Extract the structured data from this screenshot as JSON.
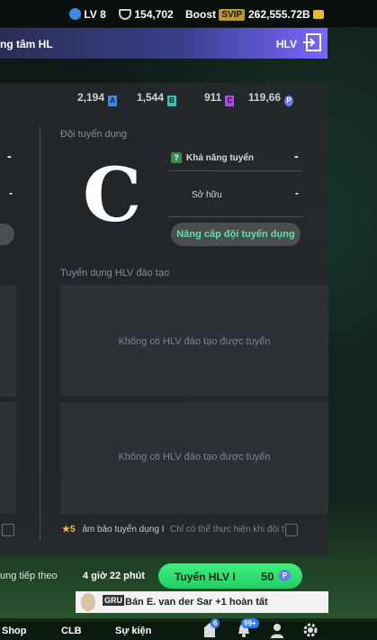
{
  "topbar": {
    "level": "LV 8",
    "points": "154,702",
    "boost_label": "Boost",
    "vip_badge": "SVIP",
    "coins": "262,555.72B"
  },
  "header": {
    "title": "ng tâm HL",
    "right_label": "HLV"
  },
  "currencies": [
    {
      "value": "2,194",
      "badge": "A",
      "color": "#3a8be8"
    },
    {
      "value": "1,544",
      "badge": "B",
      "color": "#2ec4b0"
    },
    {
      "value": "911",
      "badge": "C",
      "color": "#b04ae8"
    },
    {
      "value": "119,66",
      "badge": "P",
      "color": "#6a7ae8"
    }
  ],
  "recruit_team": {
    "label": "Đội tuyển dụng",
    "grade": "C",
    "ability_label": "Khả năng tuyển",
    "ability_value": "-",
    "owned_label": "Sở hữu",
    "owned_value": "-",
    "upgrade_button": "Nâng cấp đội tuyển dụng"
  },
  "left_values": [
    "-",
    "-"
  ],
  "training_section": {
    "label": "Tuyển dụng HLV đào tạo",
    "empty_text_1": "Không có HLV đào tạo được tuyển",
    "empty_text_2": "Không có HLV đào tạo được tuyển"
  },
  "guarantee": {
    "stars": "★5",
    "text": "ảm bảo tuyển dụng I",
    "note": "Chỉ có thể thực hiện khi đội t"
  },
  "action": {
    "next_label": "ung tiếp theo",
    "timer": "4 giờ 22 phút",
    "recruit_button": "Tuyển HLV I",
    "cost": "50"
  },
  "notification": {
    "club_tag": "GRU",
    "text": "Bán E. van der Sar +1 hoàn tất"
  },
  "bottom_nav": {
    "shop": "Shop",
    "club": "CLB",
    "events": "Sự kiện",
    "badge_1": "6",
    "badge_2": "99+"
  }
}
